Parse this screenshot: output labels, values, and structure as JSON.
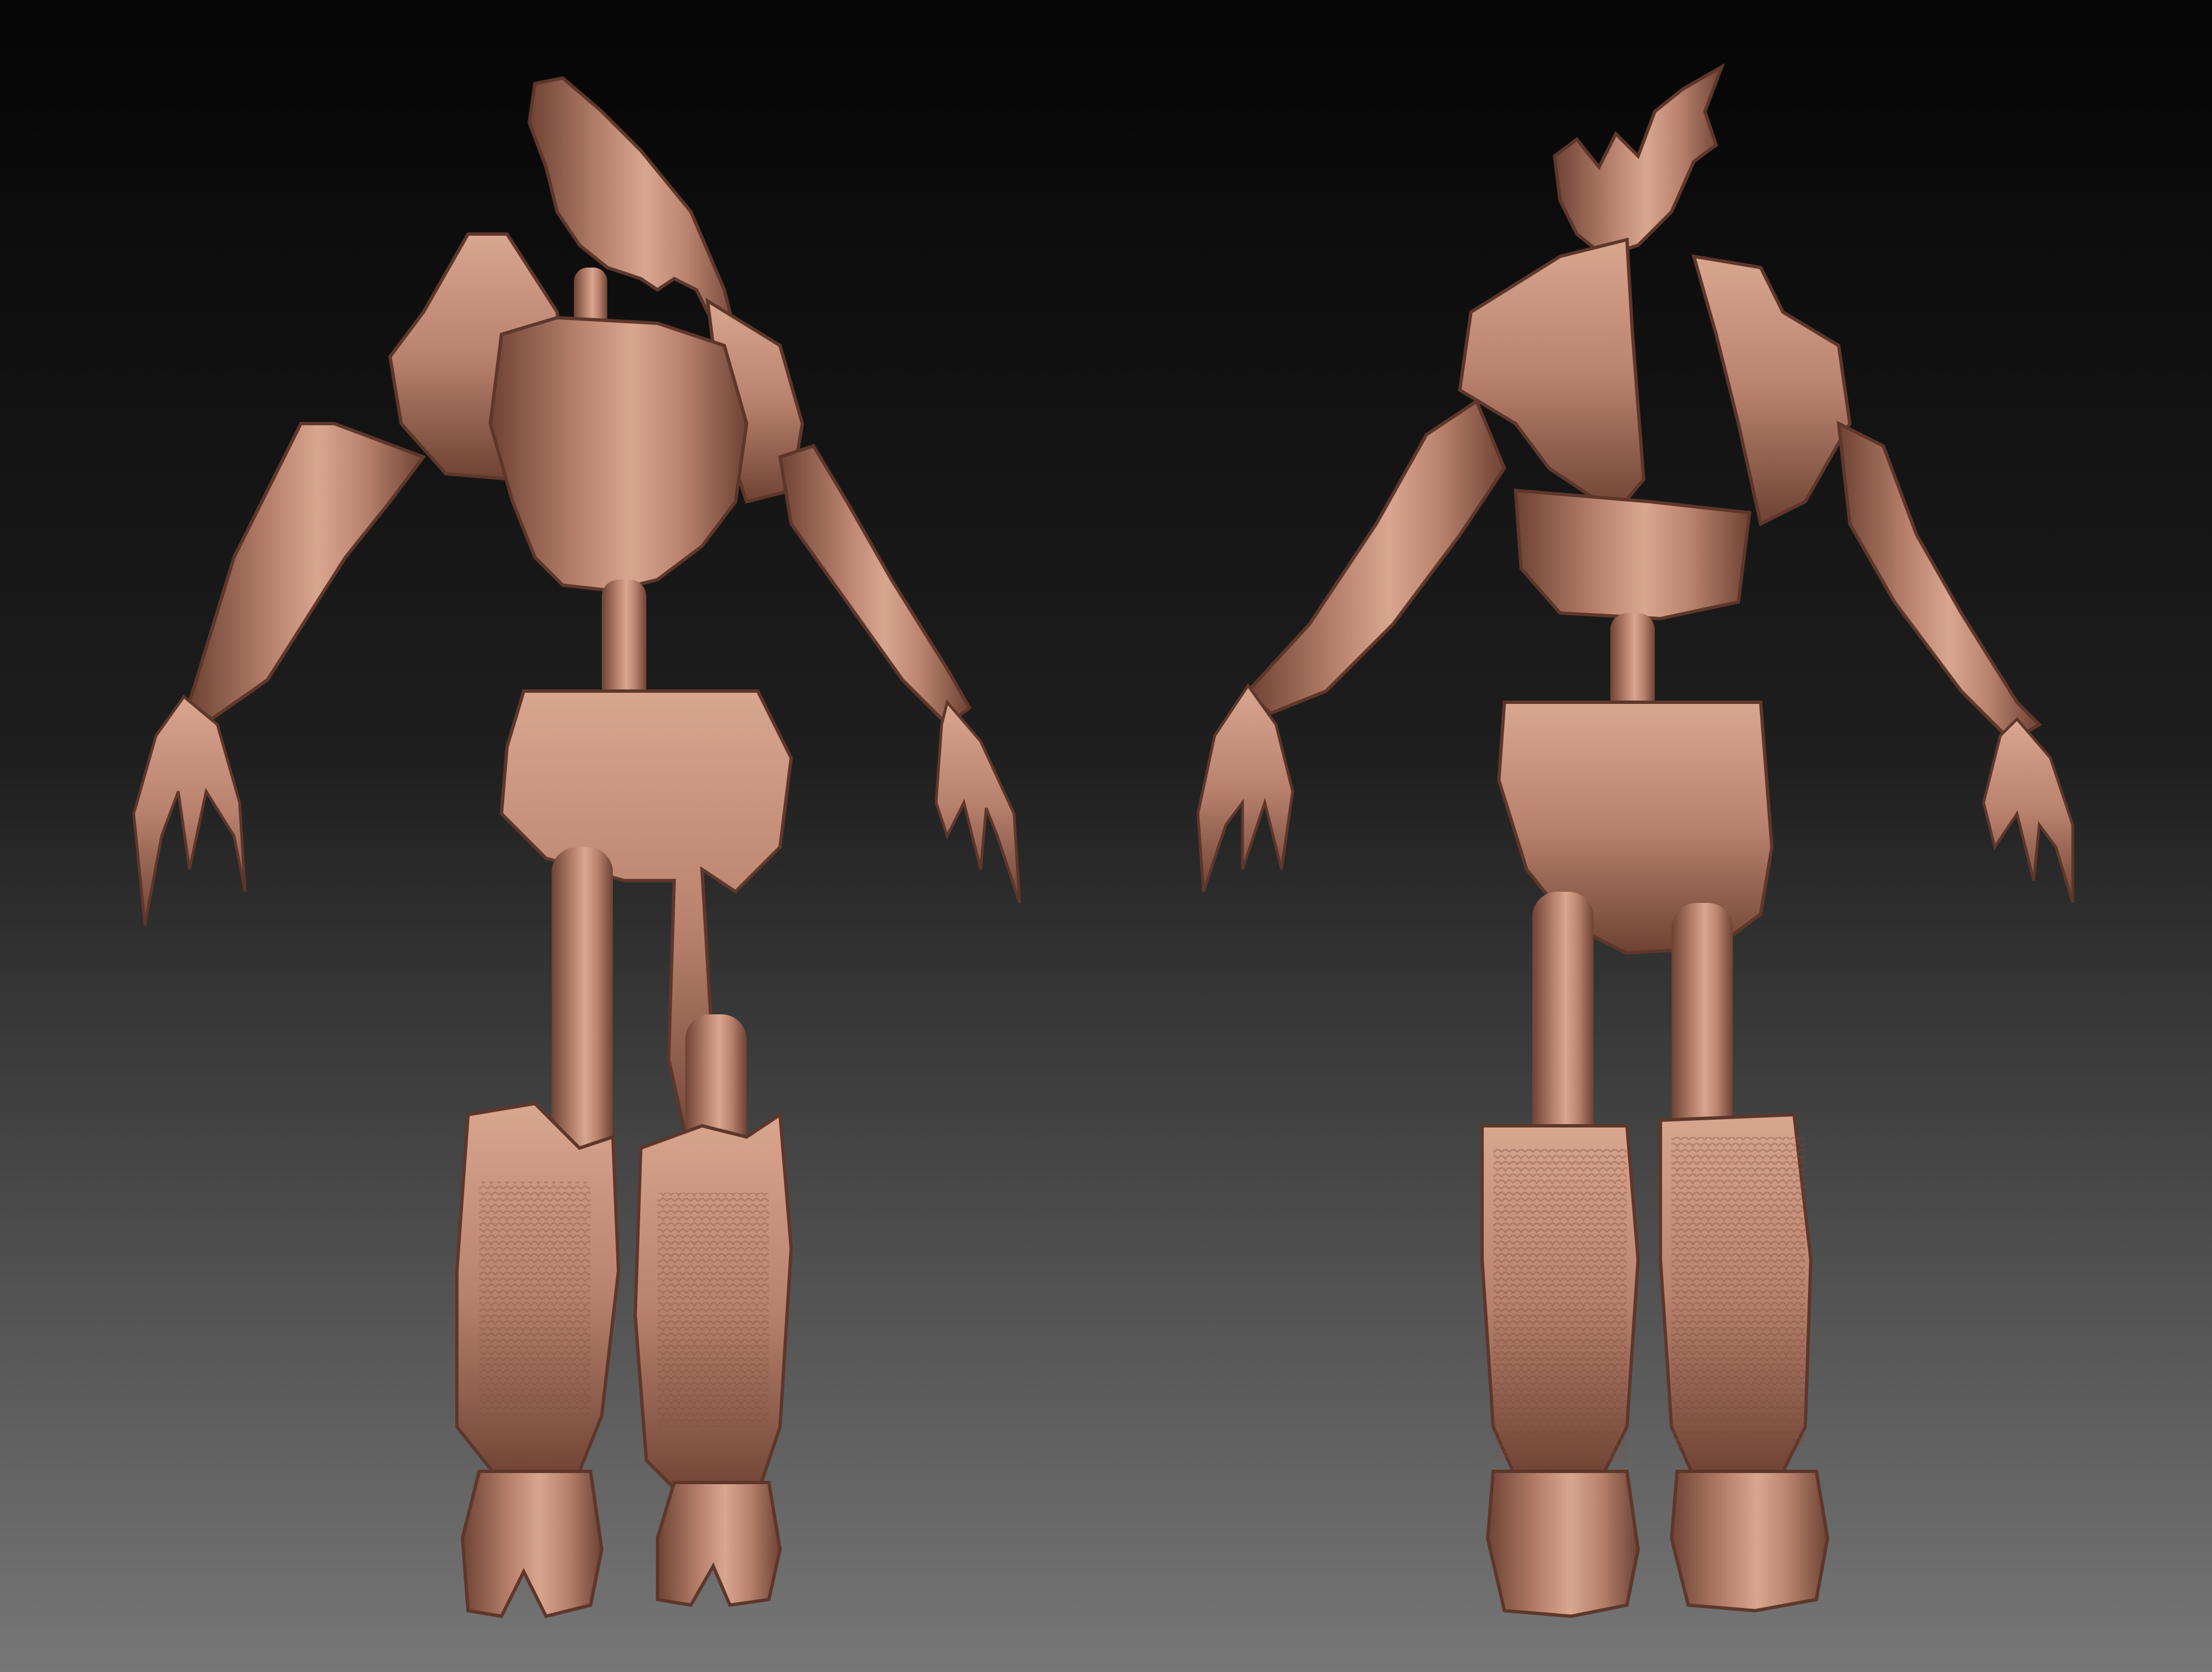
{
  "scene": {
    "background_top": "#050505",
    "background_bottom": "#777777",
    "clay_base": "#b9826e",
    "clay_light": "#d9a690",
    "clay_dark": "#6e4234"
  },
  "views": [
    {
      "view": "front"
    },
    {
      "view": "back"
    }
  ]
}
